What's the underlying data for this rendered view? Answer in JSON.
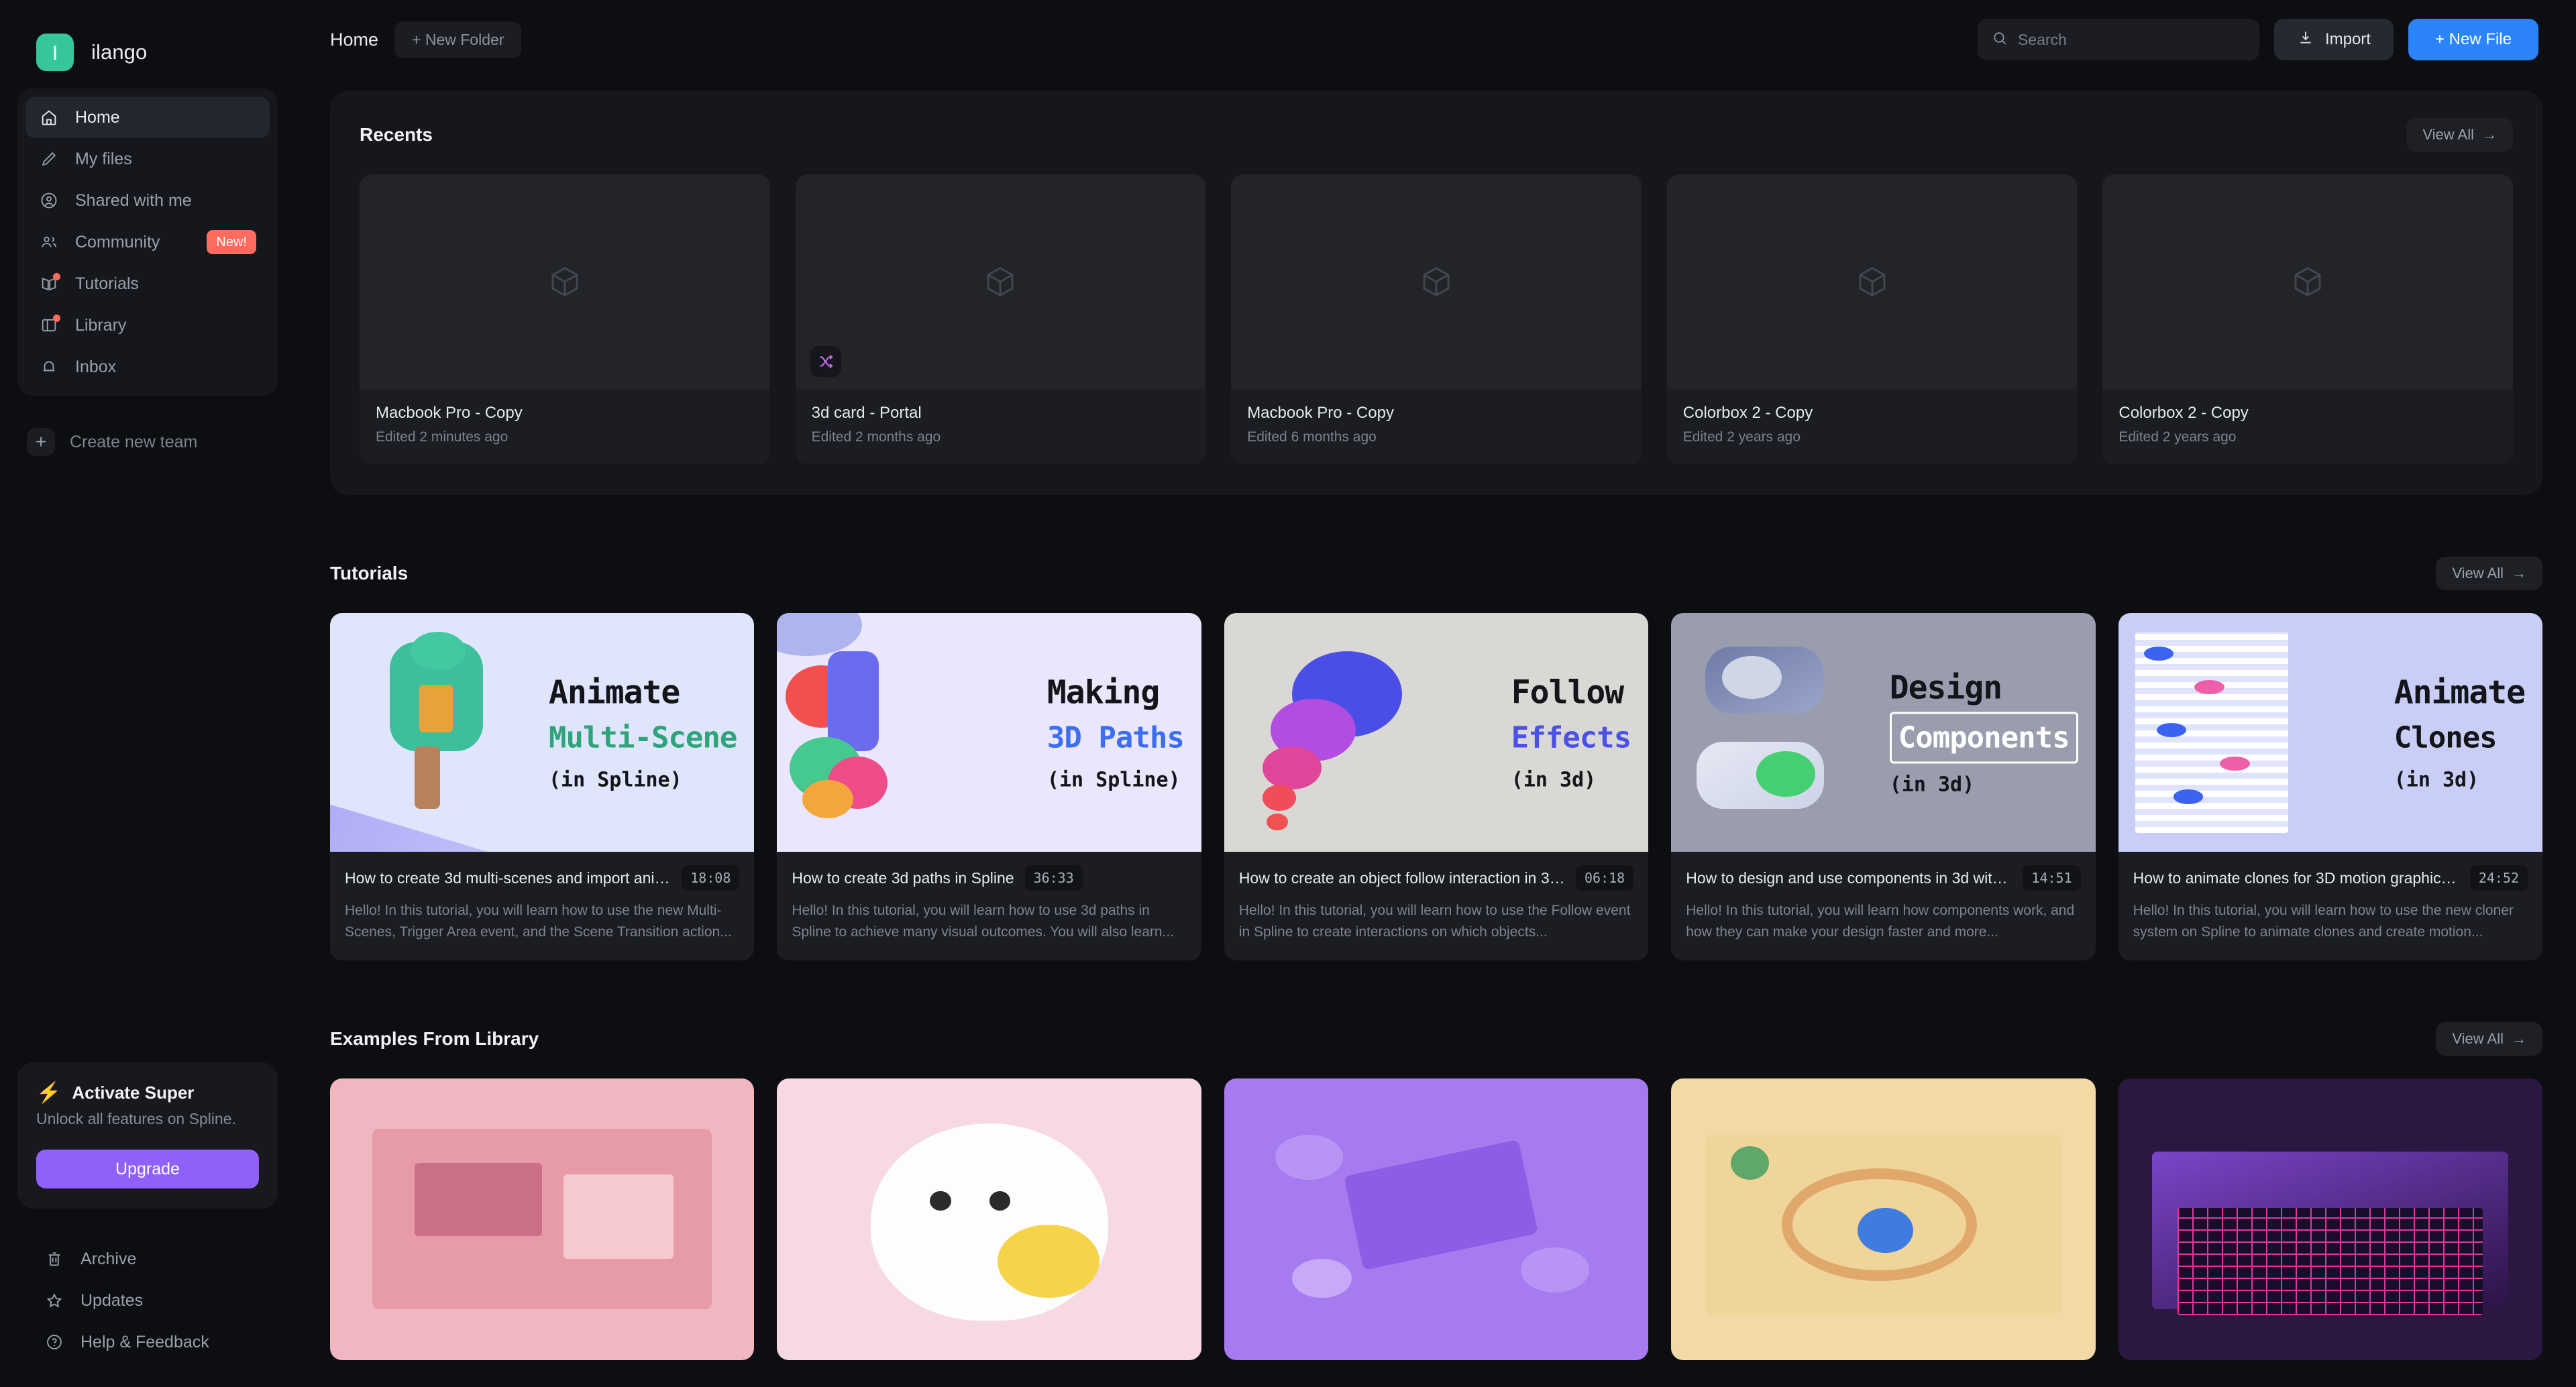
{
  "brand": {
    "initial": "I",
    "name": "ilango"
  },
  "sidebar": {
    "items": [
      {
        "label": "Home",
        "icon": "home-icon",
        "active": true
      },
      {
        "label": "My files",
        "icon": "pencil-icon"
      },
      {
        "label": "Shared with me",
        "icon": "user-circle-icon"
      },
      {
        "label": "Community",
        "icon": "people-icon",
        "badge": "New!"
      },
      {
        "label": "Tutorials",
        "icon": "book-icon",
        "dot": true
      },
      {
        "label": "Library",
        "icon": "panel-icon",
        "dot": true
      },
      {
        "label": "Inbox",
        "icon": "bell-icon"
      }
    ],
    "create_team": "Create new team",
    "super": {
      "title": "Activate Super",
      "subtitle": "Unlock all features on Spline.",
      "button": "Upgrade",
      "accent": "#9061fa"
    },
    "bottom_items": [
      {
        "label": "Archive",
        "icon": "trash-icon"
      },
      {
        "label": "Updates",
        "icon": "star-icon"
      },
      {
        "label": "Help & Feedback",
        "icon": "question-circle-icon"
      }
    ]
  },
  "topbar": {
    "breadcrumb": "Home",
    "new_folder": "+ New Folder",
    "search_placeholder": "Search",
    "search_value": "",
    "import": "Import",
    "new_file": "+ New File",
    "accent": "#2b84fb"
  },
  "recents": {
    "title": "Recents",
    "view_all": "View All",
    "cards": [
      {
        "name": "Macbook Pro - Copy",
        "edited": "Edited 2 minutes ago"
      },
      {
        "name": "3d card - Portal",
        "edited": "Edited 2 months ago",
        "chip": "shuffle-icon"
      },
      {
        "name": "Macbook Pro - Copy",
        "edited": "Edited 6 months ago"
      },
      {
        "name": "Colorbox 2 - Copy",
        "edited": "Edited 2 years ago"
      },
      {
        "name": "Colorbox 2 - Copy",
        "edited": "Edited 2 years ago"
      }
    ]
  },
  "tutorials": {
    "title": "Tutorials",
    "view_all": "View All",
    "cards": [
      {
        "thumb": {
          "line1": "Animate",
          "line2": "Multi-Scene",
          "line3": "(in Spline)",
          "line2_color": "#2fa37a",
          "bg": "#dfe6fb"
        },
        "title": "How to create 3d multi-scenes and import anima...",
        "duration": "18:08",
        "desc": "Hello! In this tutorial, you will learn how to use the new Multi-Scenes, Trigger Area event, and the Scene Transition action..."
      },
      {
        "thumb": {
          "line1": "Making",
          "line2": "3D Paths",
          "line3": "(in Spline)",
          "line2_color": "#3b6ef0",
          "bg": "#eae6fb"
        },
        "title": "How to create 3d paths in Spline",
        "duration": "36:33",
        "desc": "Hello! In this tutorial, you will learn how to use 3d paths in Spline to achieve many visual outcomes. You will also learn..."
      },
      {
        "thumb": {
          "line1": "Follow",
          "line2": "Effects",
          "line3": "(in 3d)",
          "line2_color": "#4b51e8",
          "bg": "#d9d8d4"
        },
        "title": "How to create an object follow interaction in 3d ...",
        "duration": "06:18",
        "desc": "Hello! In this tutorial, you will learn how to use the Follow event in Spline to create interactions on which objects..."
      },
      {
        "thumb": {
          "line1": "Design",
          "line2": "Components",
          "line3": "(in 3d)",
          "line2_color": "#ffffff",
          "bg": "#9a9dad",
          "boxed": true
        },
        "title": "How to design and use components in 3d with Sp...",
        "duration": "14:51",
        "desc": "Hello! In this tutorial, you will learn how components work, and how they can make your design faster and more..."
      },
      {
        "thumb": {
          "line1": "Animate",
          "line2": "Clones",
          "line3": "(in 3d)",
          "line2_color": "#14151a",
          "bg": "#c9cef7"
        },
        "title": "How to animate clones for 3D motion graphics on...",
        "duration": "24:52",
        "desc": "Hello! In this tutorial, you will learn how to use the new cloner system on Spline to animate clones and create motion..."
      }
    ]
  },
  "examples": {
    "title": "Examples From Library",
    "view_all": "View All",
    "cards": [
      {
        "name": "pink-room-scene",
        "bg": "#f0b7c0"
      },
      {
        "name": "white-bunny-scene",
        "bg": "#f6d9e2"
      },
      {
        "name": "purple-icons-scene",
        "bg": "#a77bf0"
      },
      {
        "name": "isometric-park-scene",
        "bg": "#f3d9a6"
      },
      {
        "name": "laptop-scene",
        "bg": "#2a1840"
      }
    ]
  }
}
